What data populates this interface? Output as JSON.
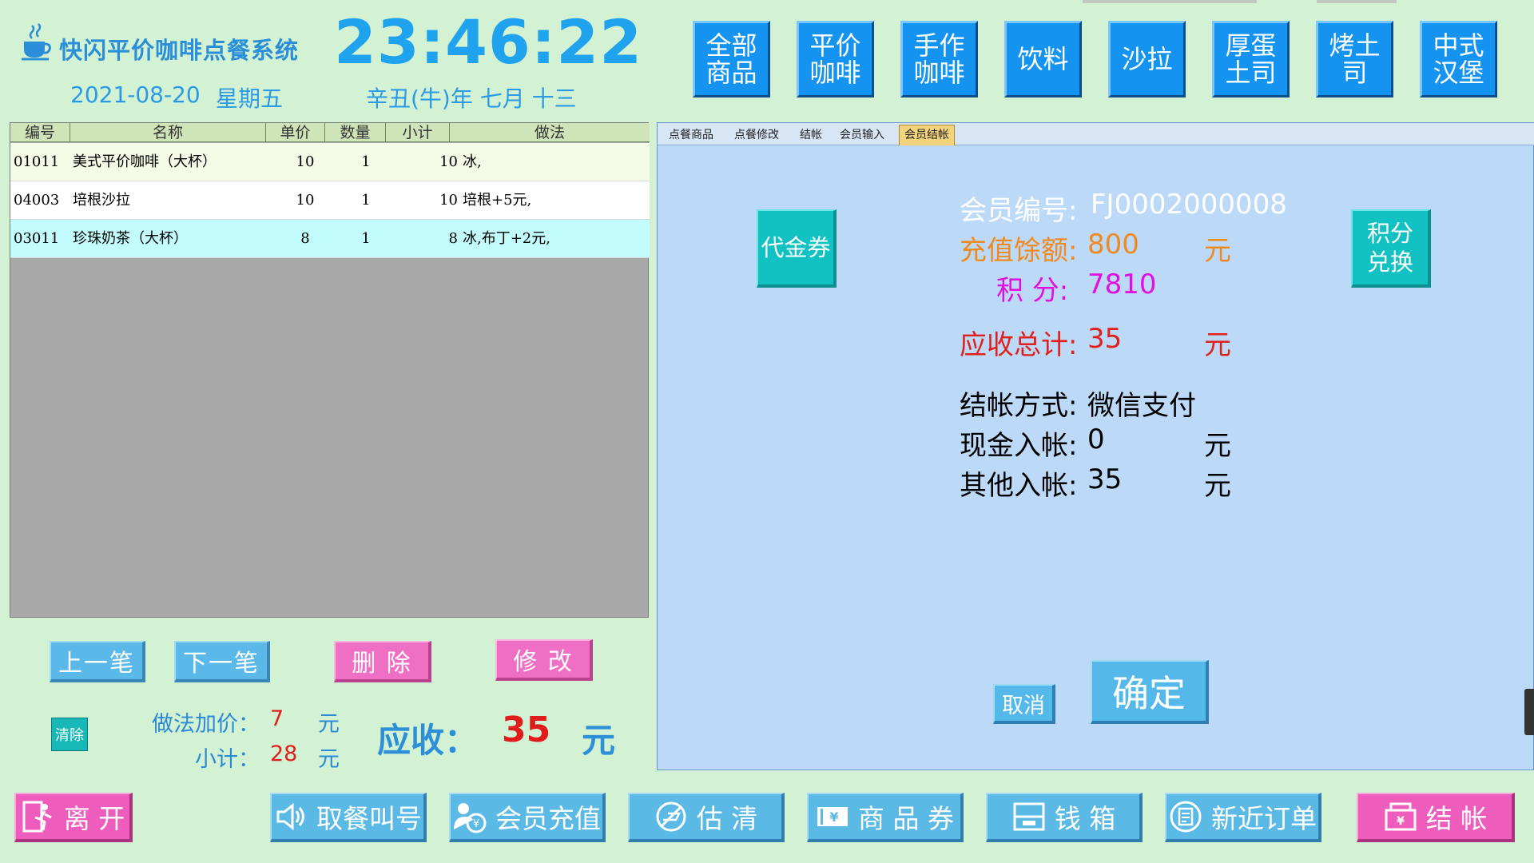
{
  "header": {
    "app_title": "快闪平价咖啡点餐系统",
    "clock": "23:46:22",
    "date": "2021-08-20",
    "weekday": "星期五",
    "lunar": "辛丑(牛)年 七月 十三"
  },
  "categories": [
    "全部商品",
    "平价咖啡",
    "手作咖啡",
    "饮料",
    "沙拉",
    "厚蛋土司",
    "烤土司",
    "中式汉堡"
  ],
  "order_table": {
    "columns": [
      "编号",
      "名称",
      "单价",
      "数量",
      "小计",
      "做法"
    ],
    "rows": [
      {
        "code": "01011",
        "name": "美式平价咖啡（大杯）",
        "price": "10",
        "qty": "1",
        "subtotal": "10",
        "method": "冰,"
      },
      {
        "code": "04003",
        "name": "培根沙拉",
        "price": "10",
        "qty": "1",
        "subtotal": "10",
        "method": "培根+5元,"
      },
      {
        "code": "03011",
        "name": "珍珠奶茶（大杯）",
        "price": "8",
        "qty": "1",
        "subtotal": "8",
        "method": "冰,布丁+2元,"
      }
    ]
  },
  "row_actions": {
    "prev": "上一笔",
    "next": "下一笔",
    "delete": "删 除",
    "edit": "修 改",
    "clear": "清除"
  },
  "totals": {
    "method_extra_label": "做法加价：",
    "method_extra_value": "7",
    "subtotal_label": "小计：",
    "subtotal_value": "28",
    "unit": "元",
    "receivable_label": "应收：",
    "receivable_value": "35",
    "receivable_unit": "元"
  },
  "tabs": [
    "点餐商品",
    "点餐修改",
    "结帐",
    "会员输入",
    "会员结帐"
  ],
  "member": {
    "id_label": "会员编号:",
    "id_value": "FJ0002000008",
    "balance_label": "充值馀额:",
    "balance_value": "800",
    "points_label": "积 分:",
    "points_value": "7810",
    "total_label": "应收总计:",
    "total_value": "35",
    "pay_method_label": "结帐方式:",
    "pay_method_value": "微信支付",
    "cash_label": "现金入帐:",
    "cash_value": "0",
    "other_label": "其他入帐:",
    "other_value": "35",
    "unit": "元",
    "voucher_button": "代金券",
    "points_exchange_button": "积分兑换",
    "cancel_button": "取消",
    "confirm_button": "确定"
  },
  "bottom_bar": {
    "leave": "离 开",
    "call_number": "取餐叫号",
    "member_recharge": "会员充值",
    "sold_out": "估 清",
    "product_coupon": "商 品 券",
    "cash_drawer": "钱 箱",
    "recent_orders": "新近订单",
    "checkout": "结 帐"
  },
  "colors": {
    "background": "#d3f1d3",
    "category_blue": "#1593f1",
    "panel_blue": "#bcd9f7",
    "accent_red": "#e0201c",
    "accent_orange": "#f08a1e",
    "accent_magenta": "#e010e0",
    "teal": "#12c1c1",
    "pink": "#ee5dbb"
  }
}
